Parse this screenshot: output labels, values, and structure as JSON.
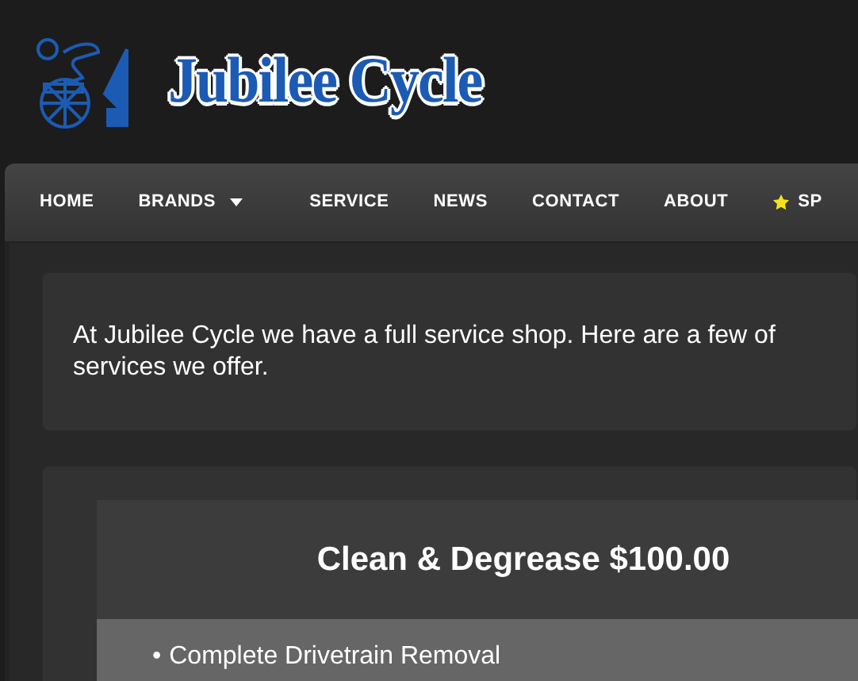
{
  "site": {
    "name": "Jubilee Cycle"
  },
  "nav": [
    {
      "label": "HOME",
      "kind": "link"
    },
    {
      "label": "BRANDS",
      "kind": "dropdown"
    },
    {
      "label": "SERVICE",
      "kind": "link"
    },
    {
      "label": "NEWS",
      "kind": "link"
    },
    {
      "label": "CONTACT",
      "kind": "link"
    },
    {
      "label": "ABOUT",
      "kind": "link"
    },
    {
      "label": "SP",
      "kind": "starred"
    }
  ],
  "intro": "At Jubilee Cycle we have a full service shop. Here are a few of\nservices we offer.",
  "service": {
    "title": "Clean & Degrease $100.00",
    "marker": "•",
    "items": [
      "Complete Drivetrain Removal"
    ]
  }
}
